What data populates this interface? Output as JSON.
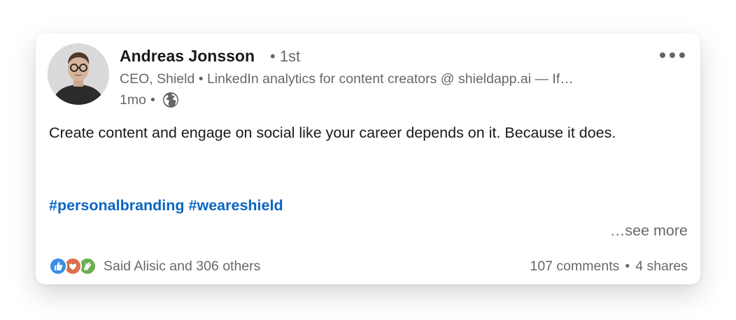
{
  "author": {
    "name": "Andreas Jonsson",
    "degree": "• 1st",
    "headline": "CEO, Shield • LinkedIn analytics for content creators @ shieldapp.ai — If…",
    "time": "1mo",
    "visibility_icon": "globe-icon"
  },
  "post": {
    "text": "Create content and engage on social like your career depends on it. Because it does.",
    "hashtags": [
      "#personalbranding",
      "#weareshield"
    ],
    "see_more": "…see more"
  },
  "social": {
    "reaction_icons": [
      "like-icon",
      "love-icon",
      "clap-icon"
    ],
    "reactors": "Said Alisic and 306 others",
    "comments": "107 comments",
    "shares": "4 shares"
  },
  "colors": {
    "link_blue": "#0a66c2",
    "text_primary": "#1a1a1a",
    "text_secondary": "#666666",
    "like_blue": "#378fe9",
    "love_red": "#df704d",
    "clap_green": "#6dae4f"
  }
}
